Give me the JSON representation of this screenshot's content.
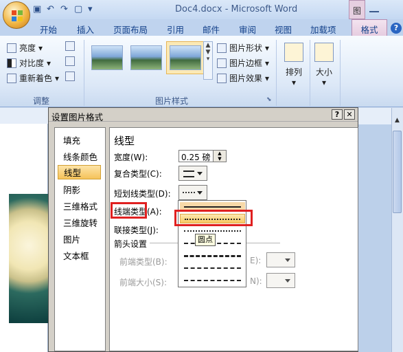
{
  "window": {
    "title": "Doc4.docx - Microsoft Word",
    "context_tab": "图"
  },
  "ribbon_tabs": [
    "开始",
    "插入",
    "页面布局",
    "引用",
    "邮件",
    "审阅",
    "视图",
    "加载项"
  ],
  "active_tab": "格式",
  "adjust_group": {
    "label": "调整",
    "brightness": "亮度",
    "contrast": "对比度",
    "recolor": "重新着色"
  },
  "picture_styles_group": {
    "label": "图片样式",
    "shape": "图片形状",
    "border": "图片边框",
    "effects": "图片效果"
  },
  "arrange": {
    "label": "排列"
  },
  "size": {
    "label": "大小"
  },
  "dialog": {
    "title": "设置图片格式",
    "help": "?",
    "close": "✕",
    "nav": [
      "填充",
      "线条颜色",
      "线型",
      "阴影",
      "三维格式",
      "三维旋转",
      "图片",
      "文本框"
    ],
    "selected_nav": "线型",
    "section_title": "线型",
    "width_label": "宽度(W):",
    "width_value": "0.25 磅",
    "compound_label": "复合类型(C):",
    "dash_label": "短划线类型(D):",
    "cap_label": "线端类型(A):",
    "join_label": "联接类型(J):",
    "arrow_section": "箭头设置",
    "begin_type": "前端类型(B):",
    "begin_size": "前端大小(S):",
    "end_type_suffix": "E):",
    "end_size_suffix": "N):",
    "tooltip": "圆点"
  }
}
